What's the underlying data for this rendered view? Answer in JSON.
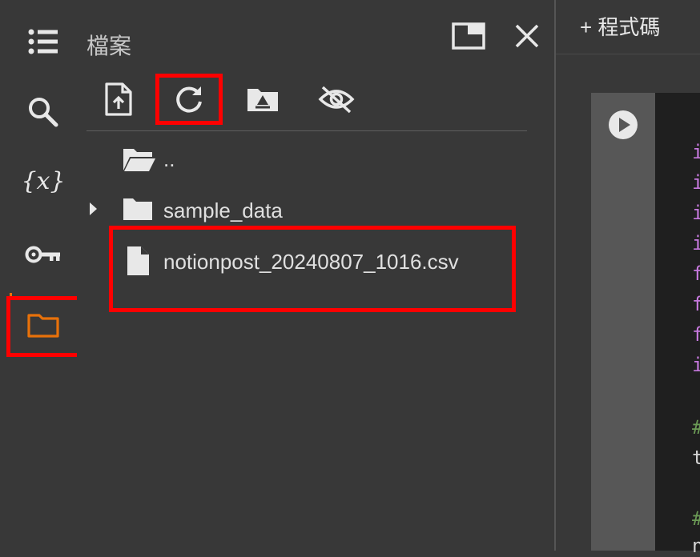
{
  "rail": {
    "items": [
      {
        "name": "toc",
        "icon": "list-icon"
      },
      {
        "name": "search",
        "icon": "search-icon"
      },
      {
        "name": "variables",
        "icon": "variables-icon",
        "text": "{x}"
      },
      {
        "name": "secrets",
        "icon": "key-icon"
      },
      {
        "name": "files",
        "icon": "folder-icon",
        "active": true,
        "active_color": "#e8710a"
      }
    ]
  },
  "files_panel": {
    "title": "檔案",
    "toolbar": [
      "upload-file-icon",
      "refresh-icon",
      "mount-drive-icon",
      "hide-files-icon"
    ],
    "items": [
      {
        "label": "..",
        "icon": "folder-open-icon"
      },
      {
        "label": "sample_data",
        "icon": "folder-icon",
        "expandable": true
      },
      {
        "label": "notionpost_20240807_1016.csv",
        "icon": "file-icon"
      }
    ]
  },
  "header": {
    "add_code": "+ 程式碼"
  },
  "code": {
    "lines": [
      {
        "text": "i",
        "color": "#c678dd"
      },
      {
        "text": "i",
        "color": "#c678dd"
      },
      {
        "text": "i",
        "color": "#c678dd"
      },
      {
        "text": "i",
        "color": "#c678dd"
      },
      {
        "text": "f",
        "color": "#c678dd"
      },
      {
        "text": "f",
        "color": "#c678dd"
      },
      {
        "text": "f",
        "color": "#c678dd"
      },
      {
        "text": "i",
        "color": "#c678dd"
      },
      {
        "text": "#",
        "color": "#6a9955"
      },
      {
        "text": "t",
        "color": "#d4d4d4"
      },
      {
        "text": "#",
        "color": "#6a9955"
      },
      {
        "text": "n",
        "color": "#d4d4d4"
      }
    ]
  },
  "colors": {
    "highlight": "#ff0000",
    "accent": "#e8710a"
  }
}
